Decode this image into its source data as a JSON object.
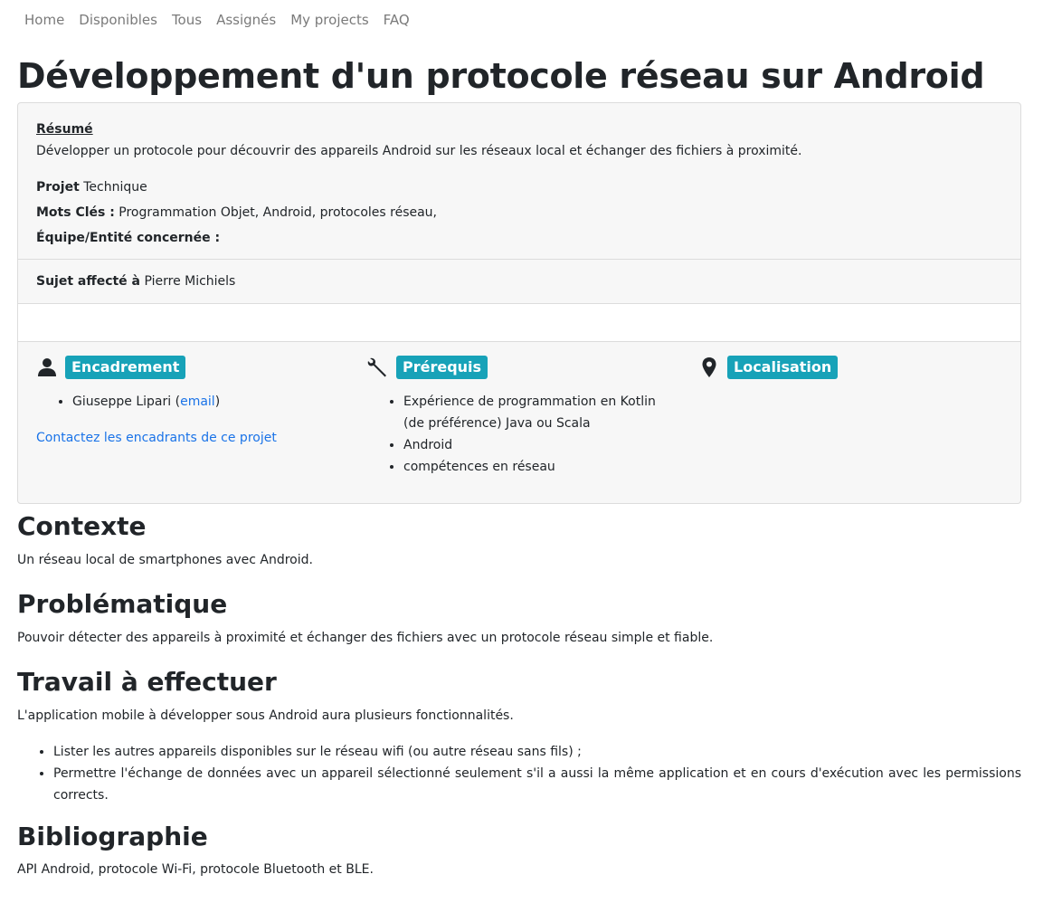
{
  "nav": {
    "items": [
      "Home",
      "Disponibles",
      "Tous",
      "Assignés",
      "My projects",
      "FAQ"
    ]
  },
  "title": "Développement d'un protocole réseau sur Android",
  "card": {
    "resume_label": "Résumé",
    "resume_text": "Développer un protocole pour découvrir des appareils Android sur les réseaux local et échanger des fichiers à proximité.",
    "projet_label": "Projet",
    "projet_value": "Technique",
    "mots_cles_label": "Mots Clés :",
    "mots_cles_value": "Programmation Objet, Android, protocoles réseau,",
    "equipe_label": "Équipe/Entité concernée :",
    "sujet_label": "Sujet affecté à",
    "sujet_value": "Pierre Michiels",
    "encadrement": {
      "badge": "Encadrement",
      "icon": "user-icon",
      "person": "Giuseppe Lipari",
      "email_label": "email",
      "contact_link": "Contactez les encadrants de ce projet"
    },
    "prerequis": {
      "badge": "Prérequis",
      "icon": "wrench-icon",
      "items": [
        "Expérience de programmation en Kotlin (de préférence) Java ou Scala",
        "Android",
        "compétences en réseau"
      ]
    },
    "localisation": {
      "badge": "Localisation",
      "icon": "map-marker-icon"
    }
  },
  "sections": {
    "contexte": {
      "heading": "Contexte",
      "text": "Un réseau local de smartphones avec Android."
    },
    "problematique": {
      "heading": "Problématique",
      "text": "Pouvoir détecter des appareils à proximité et échanger des fichiers avec un protocole réseau simple et fiable."
    },
    "travail": {
      "heading": "Travail à effectuer",
      "text": "L'application mobile à développer sous Android aura plusieurs fonctionnalités.",
      "items": [
        "Lister les autres appareils disponibles sur le réseau wifi (ou autre réseau sans fils) ;",
        "Permettre l'échange de données avec un appareil sélectionné seulement s'il a aussi la même application et en cours d'exécution avec les permissions corrects."
      ]
    },
    "bibliographie": {
      "heading": "Bibliographie",
      "text": "API Android, protocole Wi-Fi, protocole Bluetooth et BLE."
    }
  },
  "colors": {
    "badge": "#17a2b8",
    "link": "#1a73e8",
    "card_bg": "#f7f7f7"
  }
}
